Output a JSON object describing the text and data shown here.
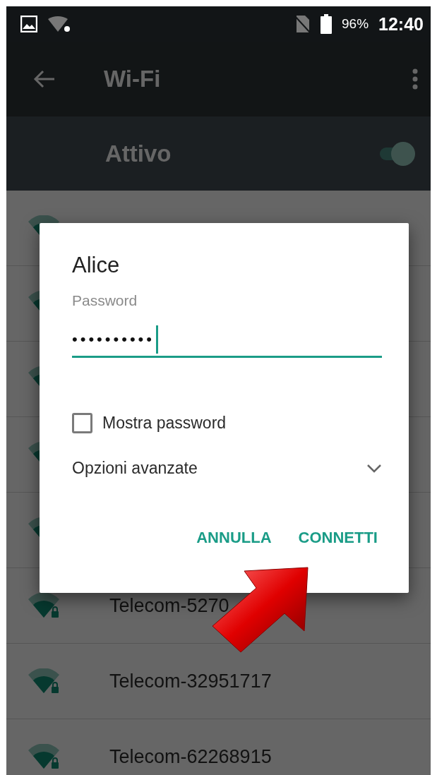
{
  "status_bar": {
    "battery": "96%",
    "time": "12:40"
  },
  "toolbar": {
    "title": "Wi-Fi"
  },
  "master_switch": {
    "label": "Attivo",
    "on": true
  },
  "networks": [
    {
      "name": "Telecom-5270",
      "locked": true
    },
    {
      "name": "Telecom-32951717",
      "locked": true
    },
    {
      "name": "Telecom-62268915",
      "locked": true
    }
  ],
  "dialog": {
    "title": "Alice",
    "field_label": "Password",
    "value": "••••••••••",
    "show_password": {
      "label": "Mostra password",
      "checked": false
    },
    "advanced": {
      "label": "Opzioni avanzate",
      "expanded": false
    },
    "buttons": [
      {
        "label": "ANNULLA"
      },
      {
        "label": "CONNETTI"
      }
    ]
  }
}
